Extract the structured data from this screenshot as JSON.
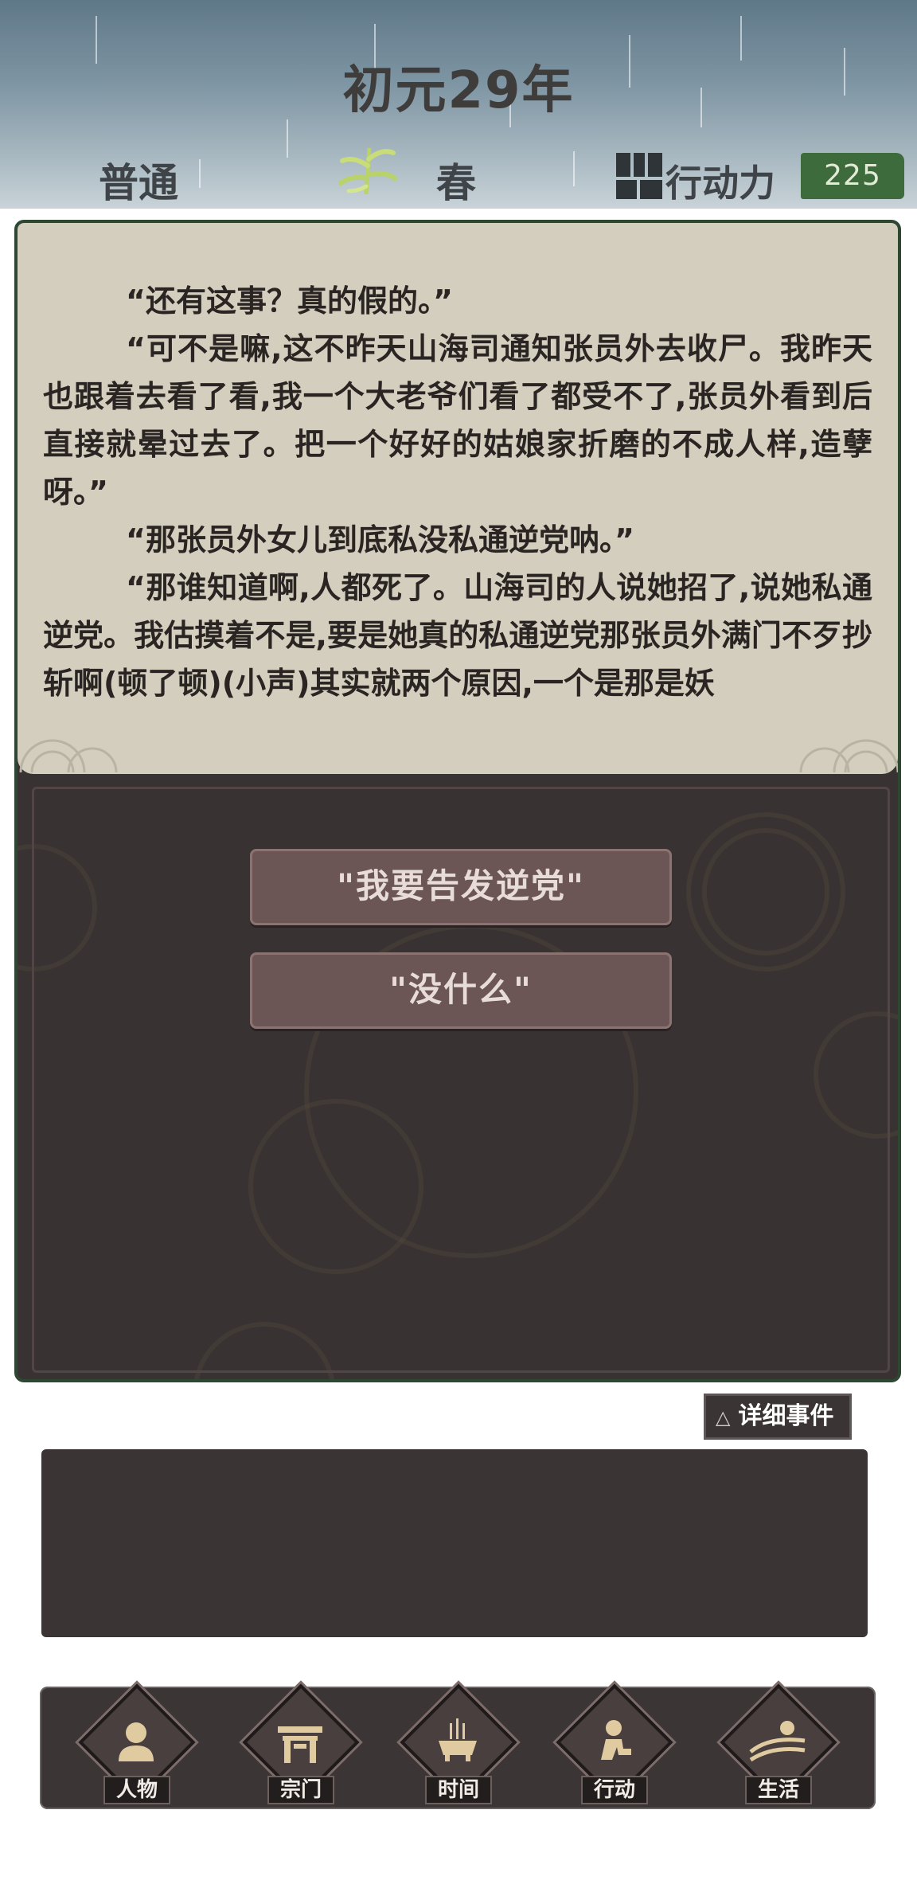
{
  "header": {
    "year_title": "初元29年",
    "difficulty": "普通",
    "season_icon": "bamboo-icon",
    "season": "春",
    "action_points_icon": "action-grid-icon",
    "action_points_label": "行动力",
    "action_points_value": "225"
  },
  "story": {
    "paragraphs": [
      "“还有这事？真的假的。”",
      "“可不是嘛,这不昨天山海司通知张员外去收尸。我昨天也跟着去看了看,我一个大老爷们看了都受不了,张员外看到后直接就晕过去了。把一个好好的姑娘家折磨的不成人样,造孽呀。”",
      "“那张员外女儿到底私没私通逆党呐。”",
      "“那谁知道啊,人都死了。山海司的人说她招了,说她私通逆党。我估摸着不是,要是她真的私通逆党那张员外满门不歹抄斩啊(顿了顿)(小声)其实就两个原因,一个是那是妖"
    ]
  },
  "choices": [
    {
      "label": "\"我要告发逆党\""
    },
    {
      "label": "\"没什么\""
    }
  ],
  "detail_button": {
    "icon": "triangle-up-icon",
    "icon_glyph": "△",
    "label": "详细事件"
  },
  "nav": [
    {
      "label": "人物",
      "icon": "person-icon"
    },
    {
      "label": "宗门",
      "icon": "sect-gate-icon"
    },
    {
      "label": "时间",
      "icon": "incense-burner-icon"
    },
    {
      "label": "行动",
      "icon": "action-figure-icon"
    },
    {
      "label": "生活",
      "icon": "landscape-icon"
    }
  ],
  "colors": {
    "panel_bg": "#393232",
    "text_box_bg": "#d3cebe",
    "choice_bg": "#6b5655",
    "ap_badge_bg": "#3e6b3c"
  }
}
